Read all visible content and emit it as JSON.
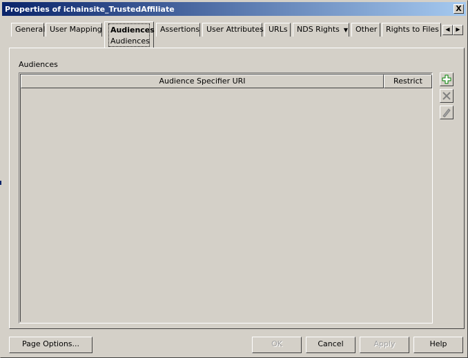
{
  "window": {
    "title": "Properties of ichainsite_TrustedAffiliate",
    "close_label": "X"
  },
  "tabs": [
    {
      "label": "General"
    },
    {
      "label": "User Mapping"
    },
    {
      "label": "Audiences",
      "sublabel": "Audiences",
      "active": true
    },
    {
      "label": "Assertions"
    },
    {
      "label": "User Attributes"
    },
    {
      "label": "URLs"
    },
    {
      "label": "NDS Rights",
      "has_dropdown": true
    },
    {
      "label": "Other"
    },
    {
      "label": "Rights to Files a"
    }
  ],
  "tab_scroll": {
    "left_icon": "left-arrow-icon",
    "right_icon": "right-arrow-icon"
  },
  "panel": {
    "section_label": "Audiences",
    "table": {
      "columns": [
        "Audience Specifier URI",
        "Restrict"
      ],
      "rows": []
    },
    "side_buttons": [
      {
        "icon": "add-icon",
        "enabled": true
      },
      {
        "icon": "delete-icon",
        "enabled": false
      },
      {
        "icon": "edit-icon",
        "enabled": false
      }
    ]
  },
  "footer": {
    "page_options": "Page Options...",
    "ok": "OK",
    "cancel": "Cancel",
    "apply": "Apply",
    "help": "Help"
  },
  "colors": {
    "title_bar": "#0a246a",
    "face": "#d4d0c8",
    "add_icon": "#008000"
  }
}
